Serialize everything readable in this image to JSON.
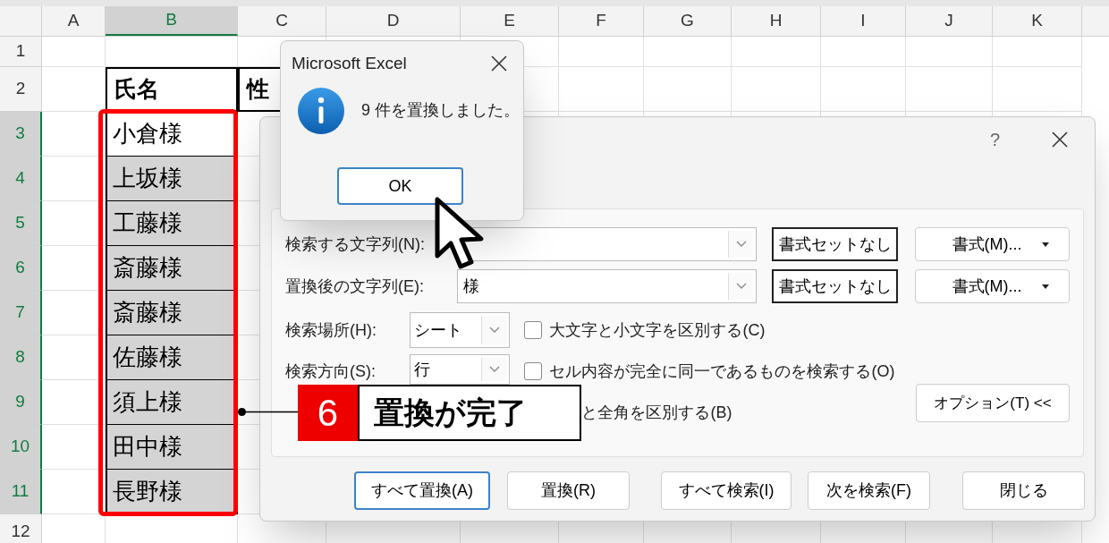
{
  "sheet": {
    "columns": [
      {
        "label": "A",
        "selected": false
      },
      {
        "label": "B",
        "selected": true
      },
      {
        "label": "C",
        "selected": false
      },
      {
        "label": "D",
        "selected": false
      },
      {
        "label": "E",
        "selected": false
      },
      {
        "label": "F",
        "selected": false
      },
      {
        "label": "G",
        "selected": false
      },
      {
        "label": "H",
        "selected": false
      },
      {
        "label": "I",
        "selected": false
      },
      {
        "label": "J",
        "selected": false
      },
      {
        "label": "K",
        "selected": false
      }
    ],
    "rows": [
      {
        "label": "1",
        "selected": false
      },
      {
        "label": "2",
        "selected": false
      },
      {
        "label": "3",
        "selected": true
      },
      {
        "label": "4",
        "selected": true
      },
      {
        "label": "5",
        "selected": true
      },
      {
        "label": "6",
        "selected": true
      },
      {
        "label": "7",
        "selected": true
      },
      {
        "label": "8",
        "selected": true
      },
      {
        "label": "9",
        "selected": true
      },
      {
        "label": "10",
        "selected": true
      },
      {
        "label": "11",
        "selected": true
      },
      {
        "label": "12",
        "selected": false
      }
    ],
    "headers": [
      "氏名",
      "性"
    ],
    "names": [
      {
        "text": "小倉様",
        "active": true
      },
      {
        "text": "上坂様",
        "active": false
      },
      {
        "text": "工藤様",
        "active": false
      },
      {
        "text": "斎藤様",
        "active": false
      },
      {
        "text": "斎藤様",
        "active": false
      },
      {
        "text": "佐藤様",
        "active": false
      },
      {
        "text": "須上様",
        "active": false
      },
      {
        "text": "田中様",
        "active": false
      },
      {
        "text": "長野様",
        "active": false
      }
    ]
  },
  "find_dialog": {
    "help": "?",
    "fields": [
      {
        "label": "検索する文字列(N):",
        "format_status": "書式セットなし",
        "format_button": "書式(M)..."
      },
      {
        "label": "置換後の文字列(E):",
        "value": "様",
        "format_status": "書式セットなし",
        "format_button": "書式(M)..."
      }
    ],
    "selects": [
      {
        "label": "検索場所(H):",
        "value": "シート"
      },
      {
        "label": "検索方向(S):",
        "value": "行"
      }
    ],
    "checks": [
      {
        "label": "大文字と小文字を区別する(C)",
        "checked": false
      },
      {
        "label": "セル内容が完全に同一であるものを検索する(O)",
        "checked": false
      },
      {
        "label": "と全角を区別する(B)"
      }
    ],
    "options_button": "オプション(T) <<",
    "buttons": [
      {
        "label": "すべて置換(A)",
        "focused": true
      },
      {
        "label": "置換(R)",
        "focused": false
      },
      {
        "label": "すべて検索(I)",
        "focused": false
      },
      {
        "label": "次を検索(F)",
        "focused": false
      },
      {
        "label": "閉じる",
        "focused": false
      }
    ]
  },
  "message_box": {
    "title": "Microsoft Excel",
    "message": "9 件を置換しました。",
    "ok": {
      "label": "OK",
      "focused": true
    }
  },
  "callout": {
    "number": "6",
    "text": "置換が完了"
  }
}
